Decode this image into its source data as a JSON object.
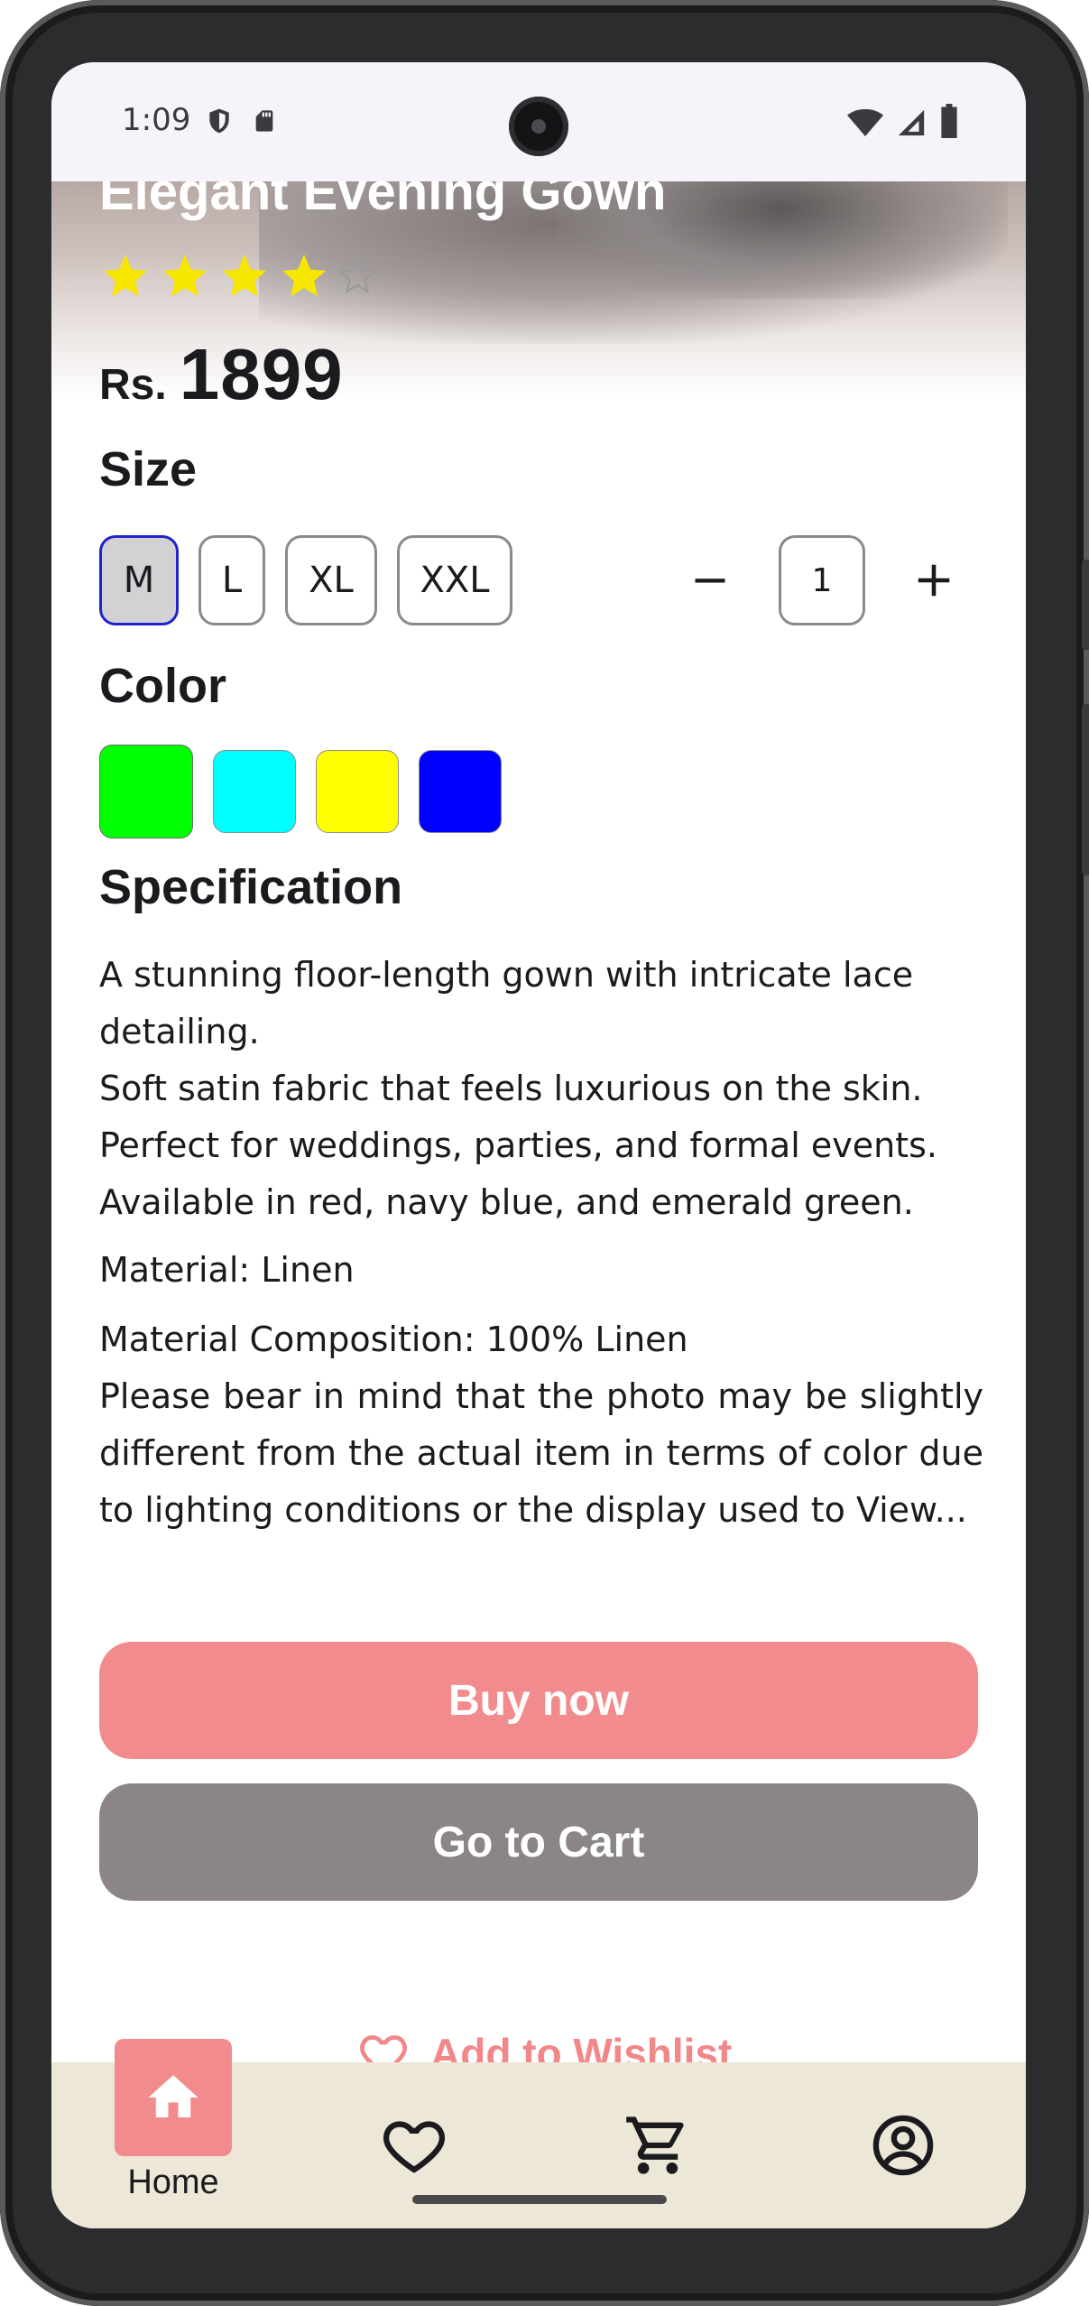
{
  "status_bar": {
    "time": "1:09"
  },
  "product": {
    "title": "Elegant Evening Gown",
    "rating": 4,
    "rating_max": 5,
    "currency": "Rs.",
    "price": "1899"
  },
  "size": {
    "heading": "Size",
    "options": [
      "M",
      "L",
      "XL",
      "XXL"
    ],
    "selected": "M"
  },
  "quantity": {
    "value": "1",
    "minus_icon": "minus-icon",
    "plus_icon": "plus-icon"
  },
  "color": {
    "heading": "Color",
    "swatches": [
      "#00ff00",
      "#00ffff",
      "#ffff00",
      "#0000ff"
    ],
    "selected_index": 0
  },
  "specification": {
    "heading": "Specification",
    "description": "A stunning floor-length gown with intricate lace detailing.\nSoft satin fabric that feels luxurious on the skin.\nPerfect for weddings, parties, and formal events.\nAvailable in red, navy blue, and emerald green.",
    "material": "Material: Linen",
    "composition": "Material Composition: 100% Linen",
    "disclaimer": "Please bear in mind that the photo may be slightly different from the actual item in terms of color due to lighting conditions or the display used to View..."
  },
  "actions": {
    "buy_now": "Buy now",
    "go_to_cart": "Go to Cart",
    "add_to_wishlist": "Add to Wishlist",
    "buy_color": "#f28b8d",
    "cart_color": "#8b8586"
  },
  "bottom_nav": {
    "items": [
      {
        "label": "Home",
        "icon": "home-icon",
        "active": true
      },
      {
        "label": "",
        "icon": "heart-icon",
        "active": false
      },
      {
        "label": "",
        "icon": "cart-icon",
        "active": false
      },
      {
        "label": "",
        "icon": "account-icon",
        "active": false
      }
    ]
  }
}
